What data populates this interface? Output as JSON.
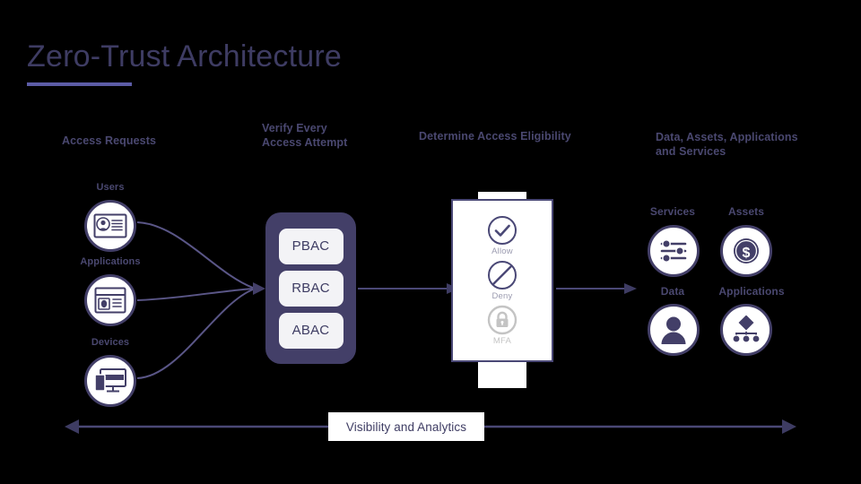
{
  "page": {
    "title": "Zero-Trust Architecture",
    "background_color": "#000000",
    "accent_color": "#433f68",
    "underline_color": "#5c5ca6",
    "text_color": "#4a4870"
  },
  "stage_headers": [
    {
      "id": "access-requests",
      "label": "Access Requests"
    },
    {
      "id": "verify-every-access-attempt",
      "line1": "Verify Every",
      "line2": "Access Attempt"
    },
    {
      "id": "determine-access-eligibility",
      "label": "Determine Access Eligibility"
    },
    {
      "id": "data-assets-applications-and-services",
      "line1": "Data, Assets, Applications",
      "line2": "and Services"
    }
  ],
  "sources": [
    {
      "label": "Users",
      "icon": "id-badge-icon"
    },
    {
      "label": "Applications",
      "icon": "app-window-icon"
    },
    {
      "label": "Devices",
      "icon": "devices-icon"
    }
  ],
  "policy": {
    "chips": [
      {
        "label": "PBAC"
      },
      {
        "label": "RBAC"
      },
      {
        "label": "ABAC"
      }
    ],
    "box_color": "#433f68",
    "chip_color": "#f3f3f6"
  },
  "decisions": [
    {
      "label": "Allow",
      "icon": "check-circle-icon",
      "color": "#4a4876",
      "state": "active"
    },
    {
      "label": "Deny",
      "icon": "no-entry-circle-icon",
      "color": "#4a4876",
      "state": "active"
    },
    {
      "label": "MFA",
      "icon": "lock-circle-icon",
      "color": "#c4c4c4",
      "state": "muted"
    }
  ],
  "assets": [
    {
      "label": "Services",
      "icon": "sliders-icon"
    },
    {
      "label": "Assets",
      "icon": "dollar-coin-icon"
    },
    {
      "label": "Data",
      "icon": "user-icon"
    },
    {
      "label": "Applications",
      "icon": "network-diamond-icon"
    }
  ],
  "footer": {
    "label": "Visibility and Analytics",
    "arrow": "double-headed-arrow"
  }
}
